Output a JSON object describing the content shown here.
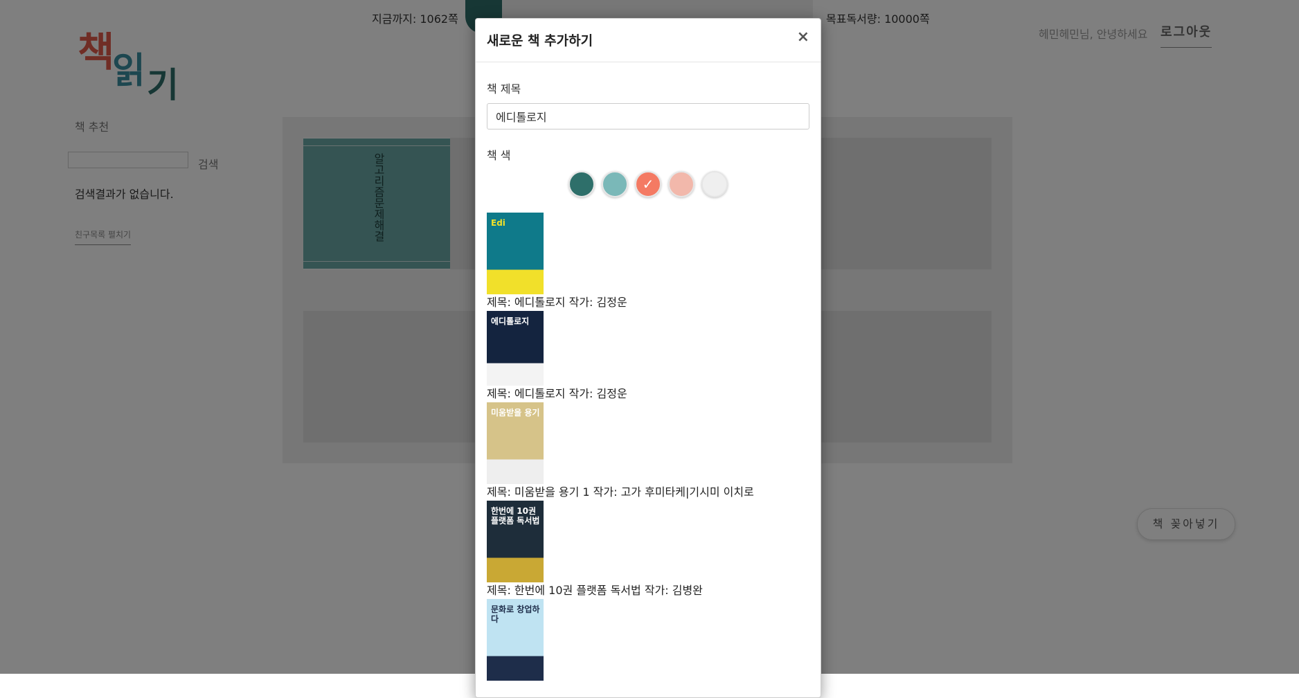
{
  "header": {
    "read_so_far": "지금까지: 1062쪽",
    "progress_fraction": 0.1062,
    "goal": "목표독서량: 10000쪽",
    "greeting": "헤민헤민님, 안녕하세요",
    "logout": "로그아웃"
  },
  "logo_text": "책읽기",
  "sidebar": {
    "recommend_label": "책 추천",
    "search_button": "검색",
    "search_value": "",
    "no_result": "검색결과가 없습니다.",
    "friends_link": "친구목록 펼치기"
  },
  "shelf": {
    "book_title": "알고리즘 문제 해결",
    "book_color": "#6aa9a6"
  },
  "insert_button": "책 꽂아넣기",
  "modal": {
    "title": "새로운 책 추가하기",
    "close": "×",
    "title_label": "책 제목",
    "title_value": "에디톨로지",
    "color_label": "책 색",
    "colors": [
      "#2e6f6a",
      "#7ab8b8",
      "#f47a63",
      "#f2b8ab",
      "#efefef"
    ],
    "selected_color_index": 2,
    "check_glyph": "✓",
    "results": [
      {
        "caption": "제목: 에디톨로지 작가: 김정운",
        "cover_text": "Edi",
        "cover_colors": [
          "#0f7a8a",
          "#f1e02a"
        ]
      },
      {
        "caption": "제목: 에디톨로지 작가: 김정운",
        "cover_text": "에디톨로지",
        "cover_colors": [
          "#14243f",
          "#f3f3f3"
        ]
      },
      {
        "caption": "제목: 미움받을 용기 1 작가: 고가 후미타케|기시미 이치로",
        "cover_text": "미움받을 용기",
        "cover_colors": [
          "#d6c389",
          "#eeeeee"
        ]
      },
      {
        "caption": "제목: 한번에 10권 플랫폼 독서법 작가: 김병완",
        "cover_text": "한번에 10권 플랫폼 독서법",
        "cover_colors": [
          "#1e2d3a",
          "#c9a834"
        ]
      },
      {
        "caption": "",
        "cover_text": "문화로 창업하다",
        "cover_colors": [
          "#bfe3f2",
          "#1e2d4a"
        ]
      }
    ]
  }
}
